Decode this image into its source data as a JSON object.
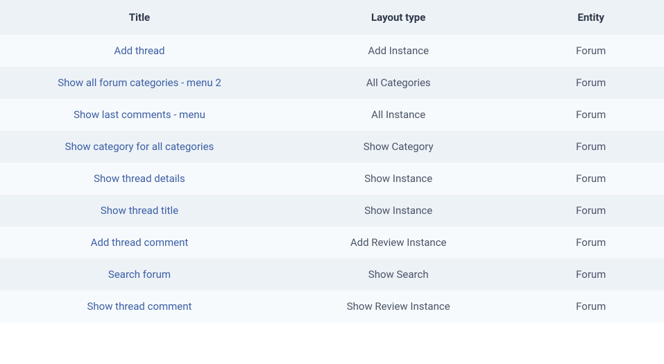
{
  "table": {
    "headers": {
      "title": "Title",
      "layout_type": "Layout type",
      "entity": "Entity"
    },
    "rows": [
      {
        "title": "Add thread",
        "layout_type": "Add Instance",
        "entity": "Forum"
      },
      {
        "title": "Show all forum categories - menu 2",
        "layout_type": "All Categories",
        "entity": "Forum"
      },
      {
        "title": "Show last comments - menu",
        "layout_type": "All Instance",
        "entity": "Forum"
      },
      {
        "title": "Show category for all categories",
        "layout_type": "Show Category",
        "entity": "Forum"
      },
      {
        "title": "Show thread details",
        "layout_type": "Show Instance",
        "entity": "Forum"
      },
      {
        "title": "Show thread title",
        "layout_type": "Show Instance",
        "entity": "Forum"
      },
      {
        "title": "Add thread comment",
        "layout_type": "Add Review Instance",
        "entity": "Forum"
      },
      {
        "title": "Search forum",
        "layout_type": "Show Search",
        "entity": "Forum"
      },
      {
        "title": "Show thread comment",
        "layout_type": "Show Review Instance",
        "entity": "Forum"
      }
    ]
  }
}
